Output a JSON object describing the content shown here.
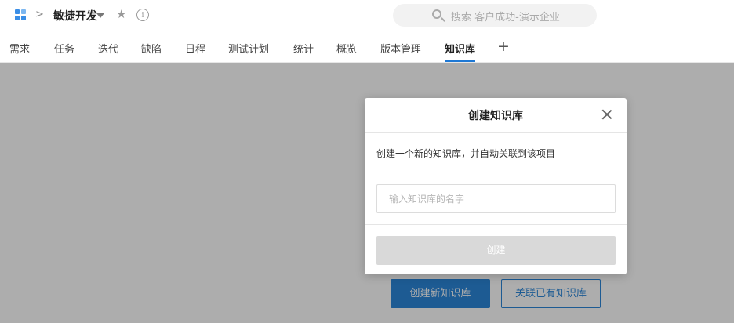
{
  "header": {
    "app_icon": "apps-grid-icon",
    "breadcrumb_separator": ">",
    "project_name": "敏捷开发",
    "star_icon": "star-icon",
    "info_icon": "info-icon",
    "search_placeholder": "搜索 客户成功-演示企业"
  },
  "tabs": [
    {
      "label": "需求"
    },
    {
      "label": "任务"
    },
    {
      "label": "迭代"
    },
    {
      "label": "缺陷"
    },
    {
      "label": "日程"
    },
    {
      "label": "测试计划"
    },
    {
      "label": "统计"
    },
    {
      "label": "概览"
    },
    {
      "label": "版本管理"
    },
    {
      "label": "知识库",
      "active": true
    }
  ],
  "tab_add": "+",
  "background_actions": {
    "create_new": "创建新知识库",
    "link_existing": "关联已有知识库"
  },
  "modal": {
    "title": "创建知识库",
    "description": "创建一个新的知识库，并自动关联到该项目",
    "input_placeholder": "输入知识库的名字",
    "input_value": "",
    "submit_label": "创建"
  },
  "colors": {
    "accent": "#2b86d9",
    "tab_underline": "#1e78d4",
    "disabled_button": "#d9d9d9"
  }
}
